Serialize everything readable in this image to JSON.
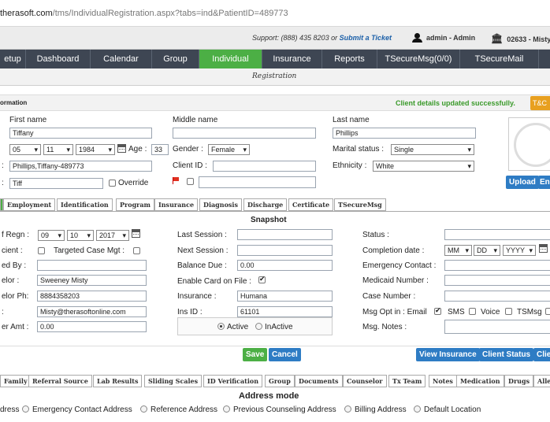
{
  "browser": {
    "url_host": "therasoft.com",
    "url_path": "/tms/IndividualRegistration.aspx?tabs=ind&PatientID=489773"
  },
  "support": {
    "text": "Support: (888) 435 8203 or",
    "link": "Submit a Ticket",
    "user": "admin - Admin",
    "org": "02633 - Misty"
  },
  "nav": [
    "etup",
    "Dashboard",
    "Calendar",
    "Group",
    "Individual",
    "Insurance",
    "Reports",
    "TSecureMsg(0/0)",
    "TSecureMail"
  ],
  "subbar": {
    "title": "Registration"
  },
  "section": {
    "title": "ormation",
    "message": "Client details updated successfully.",
    "tc": "T&C"
  },
  "client": {
    "first_name_label": "First name",
    "first_name": "Tiffany",
    "middle_name_label": "Middle name",
    "middle_name": "",
    "last_name_label": "Last name",
    "last_name": "Phillips",
    "dob_month": "05",
    "dob_day": "11",
    "dob_year": "1984",
    "age_label": "Age :",
    "age": "33",
    "gender_label": "Gender :",
    "gender": "Female",
    "marital_label": "Marital status :",
    "marital": "Single",
    "account": "Phillips,Tiffany-489773",
    "client_id_label": "Client ID :",
    "client_id": "",
    "ethnicity_label": "Ethnicity :",
    "ethnicity": "White",
    "nickname": "Tiff",
    "override_label": "Override",
    "upload_label": "Upload",
    "en_label": "En"
  },
  "tabs": [
    "Employment",
    "Identification",
    "Program",
    "Insurance",
    "Diagnosis",
    "Discharge",
    "Certificate",
    "TSecureMsg"
  ],
  "snapshot": {
    "title": "Snapshot",
    "regn_label": "f Regn :",
    "regn_month": "09",
    "regn_day": "10",
    "regn_year": "2017",
    "client_label": "cient :",
    "targeted_label": "Targeted Case Mgt :",
    "referred_label": "ed By :",
    "referred": "",
    "counselor_label": "elor :",
    "counselor": "Sweeney Misty",
    "counselor_ph_label": "elor Ph:",
    "counselor_ph": "8884358203",
    "email_label": ":",
    "email": "Misty@therasoftonline.com",
    "amt_label": "er Amt :",
    "amt": "0.00",
    "last_session_label": "Last Session :",
    "last_session": "",
    "next_session_label": "Next Session :",
    "next_session": "",
    "balance_label": "Balance Due :",
    "balance": "0.00",
    "card_label": "Enable Card on File :",
    "insurance_label": "Insurance :",
    "insurance": "Humana",
    "ins_id_label": "Ins ID :",
    "ins_id": "61101",
    "active_label": "Active",
    "inactive_label": "InActive",
    "status_label": "Status :",
    "status": "",
    "completion_label": "Completion date :",
    "completion_mm": "MM",
    "completion_dd": "DD",
    "completion_yyyy": "YYYY",
    "emergency_label": "Emergency Contact :",
    "medicaid_label": "Medicaid Number :",
    "case_label": "Case Number :",
    "optin_label": "Msg Opt in : Email",
    "sms_label": "SMS",
    "voice_label": "Voice",
    "tsmsg_label": "TSMsg",
    "notes_label": "Msg. Notes :"
  },
  "actions": {
    "save": "Save",
    "cancel": "Cancel",
    "view_insurance": "View Insurance",
    "client_status": "Client Status",
    "clie": "Clie"
  },
  "tabs2": [
    "Family",
    "Referral Source",
    "Lab Results",
    "Sliding Scales",
    "ID Verification",
    "Group",
    "Documents",
    "Counselor",
    "Tx Team",
    "Notes",
    "Medication",
    "Drugs",
    "Alle"
  ],
  "address": {
    "title": "Address mode",
    "options": [
      "dress",
      "Emergency Contact Address",
      "Reference Address",
      "Previous Counseling Address",
      "Billing Address",
      "Default Location"
    ]
  },
  "colors": {
    "nav_bg": "#3e4653",
    "active_green": "#4caf45",
    "button_blue": "#2e7cc4",
    "success_text": "#3a9a2a",
    "tc_orange": "#e8a020"
  }
}
